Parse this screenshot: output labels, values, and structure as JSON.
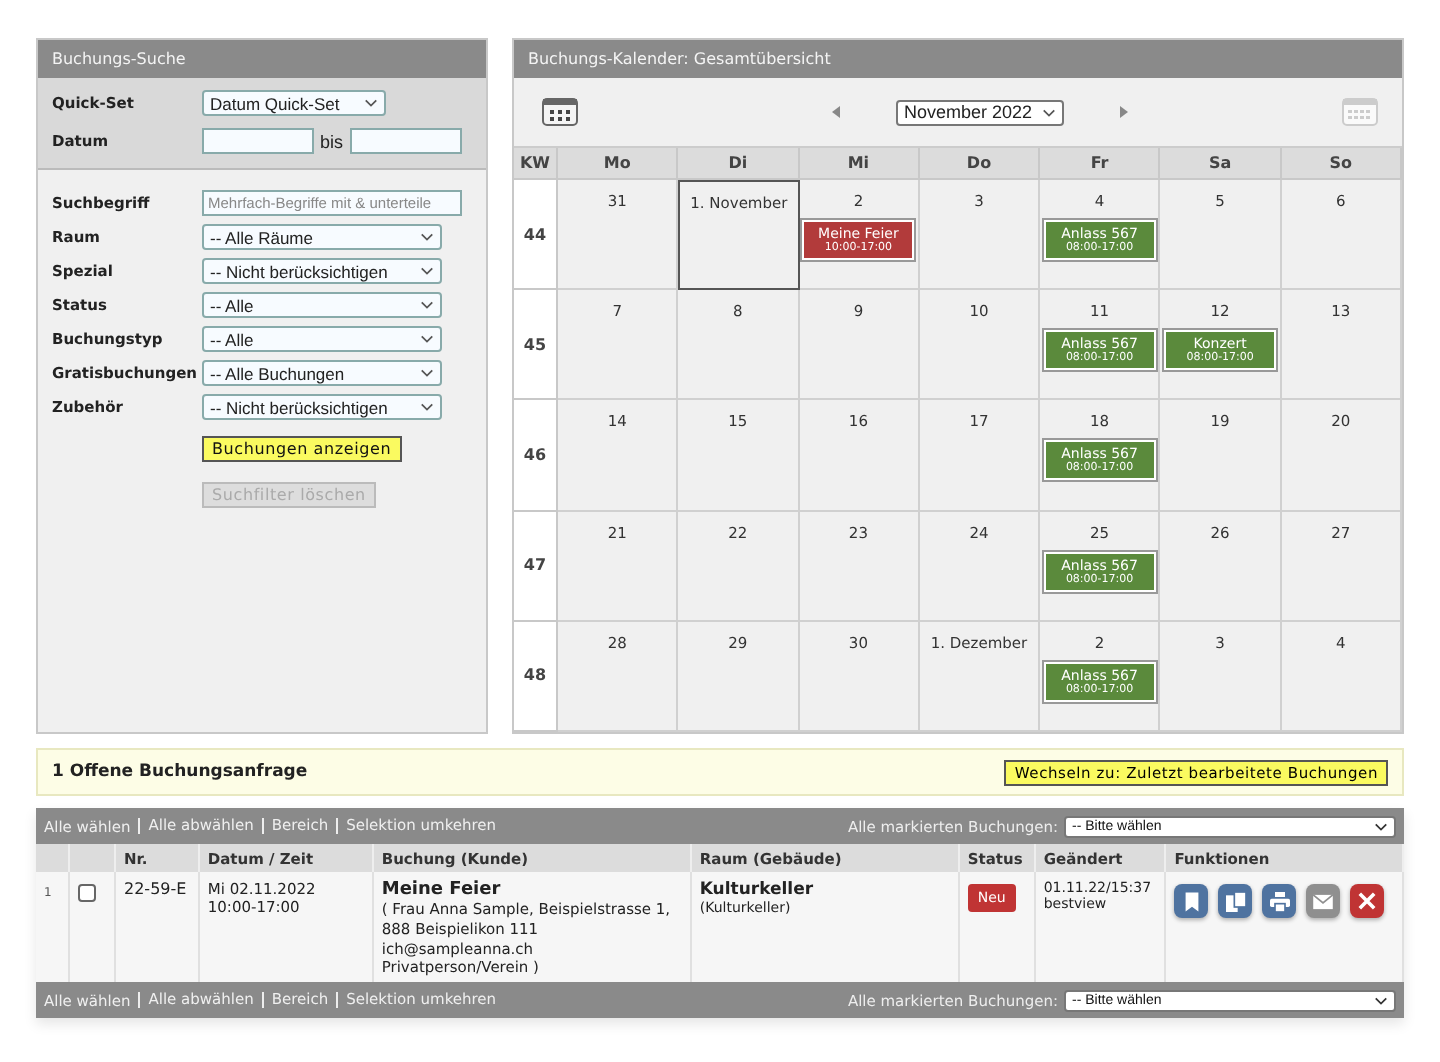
{
  "search": {
    "title": "Buchungs-Suche",
    "top_fields": [
      {
        "kind": "select",
        "label": "Quick-Set",
        "value": "Datum Quick-Set"
      },
      {
        "kind": "daterange",
        "label": "Datum",
        "separator": "bis"
      }
    ],
    "fields": [
      {
        "kind": "text",
        "label": "Suchbegriff",
        "placeholder": "Mehrfach-Begriffe mit & unterteile"
      },
      {
        "kind": "select",
        "label": "Raum",
        "value": "-- Alle Räume"
      },
      {
        "kind": "select",
        "label": "Spezial",
        "value": "-- Nicht berücksichtigen"
      },
      {
        "kind": "select",
        "label": "Status",
        "value": "-- Alle"
      },
      {
        "kind": "select",
        "label": "Buchungstyp",
        "value": "-- Alle"
      },
      {
        "kind": "select",
        "label": "Gratisbuchungen",
        "value": "-- Alle Buchungen"
      },
      {
        "kind": "select",
        "label": "Zubehör",
        "value": "-- Nicht berücksichtigen"
      }
    ],
    "buttons": [
      {
        "label": "Buchungen anzeigen",
        "disabled": false
      },
      {
        "label": "Suchfilter löschen",
        "disabled": true
      }
    ]
  },
  "calendar": {
    "title": "Buchungs-Kalender: Gesamtübersicht",
    "month": "November 2022",
    "kw_label": "KW",
    "weekdays": [
      "Mo",
      "Di",
      "Mi",
      "Do",
      "Fr",
      "Sa",
      "So"
    ],
    "weeks": [
      {
        "kw": "44",
        "days": [
          {
            "label": "31",
            "selected": false
          },
          {
            "label": "1. November",
            "selected": true
          },
          {
            "label": "2",
            "selected": false,
            "events": [
              {
                "title": "Meine Feier",
                "time": "10:00-17:00",
                "color": "#b23b3b"
              }
            ]
          },
          {
            "label": "3",
            "selected": false
          },
          {
            "label": "4",
            "selected": false,
            "events": [
              {
                "title": "Anlass 567",
                "time": "08:00-17:00",
                "color": "#5b8a3c"
              }
            ]
          },
          {
            "label": "5",
            "selected": false
          },
          {
            "label": "6",
            "selected": false
          }
        ]
      },
      {
        "kw": "45",
        "days": [
          {
            "label": "7",
            "selected": false
          },
          {
            "label": "8",
            "selected": false
          },
          {
            "label": "9",
            "selected": false
          },
          {
            "label": "10",
            "selected": false
          },
          {
            "label": "11",
            "selected": false,
            "events": [
              {
                "title": "Anlass 567",
                "time": "08:00-17:00",
                "color": "#5b8a3c"
              }
            ]
          },
          {
            "label": "12",
            "selected": false,
            "events": [
              {
                "title": "Konzert",
                "time": "08:00-17:00",
                "color": "#5b8a3c"
              }
            ]
          },
          {
            "label": "13",
            "selected": false
          }
        ]
      },
      {
        "kw": "46",
        "days": [
          {
            "label": "14",
            "selected": false
          },
          {
            "label": "15",
            "selected": false
          },
          {
            "label": "16",
            "selected": false
          },
          {
            "label": "17",
            "selected": false
          },
          {
            "label": "18",
            "selected": false,
            "events": [
              {
                "title": "Anlass 567",
                "time": "08:00-17:00",
                "color": "#5b8a3c"
              }
            ]
          },
          {
            "label": "19",
            "selected": false
          },
          {
            "label": "20",
            "selected": false
          }
        ]
      },
      {
        "kw": "47",
        "days": [
          {
            "label": "21",
            "selected": false
          },
          {
            "label": "22",
            "selected": false
          },
          {
            "label": "23",
            "selected": false
          },
          {
            "label": "24",
            "selected": false
          },
          {
            "label": "25",
            "selected": false,
            "events": [
              {
                "title": "Anlass 567",
                "time": "08:00-17:00",
                "color": "#5b8a3c"
              }
            ]
          },
          {
            "label": "26",
            "selected": false
          },
          {
            "label": "27",
            "selected": false
          }
        ]
      },
      {
        "kw": "48",
        "days": [
          {
            "label": "28",
            "selected": false
          },
          {
            "label": "29",
            "selected": false
          },
          {
            "label": "30",
            "selected": false
          },
          {
            "label": "1. Dezember",
            "selected": false
          },
          {
            "label": "2",
            "selected": false,
            "events": [
              {
                "title": "Anlass 567",
                "time": "08:00-17:00",
                "color": "#5b8a3c"
              }
            ]
          },
          {
            "label": "3",
            "selected": false
          },
          {
            "label": "4",
            "selected": false
          }
        ]
      }
    ]
  },
  "requests": {
    "heading": "1 Offene Buchungsanfrage",
    "switch_button": "Wechseln zu: Zuletzt bearbeitete Buchungen"
  },
  "table": {
    "toolbar": {
      "links": [
        "Alle wählen",
        "Alle abwählen",
        "Bereich",
        "Selektion umkehren"
      ],
      "bulk_label": "Alle markierten Buchungen:",
      "bulk_value": "-- Bitte wählen"
    },
    "columns": [
      "Nr.",
      "Datum / Zeit",
      "Buchung (Kunde)",
      "Raum (Gebäude)",
      "Status",
      "Geändert",
      "Funktionen"
    ],
    "rows": [
      {
        "index": "1",
        "checked": false,
        "nr": "22-59-E",
        "date": "Mi 02.11.2022",
        "time": "10:00-17:00",
        "booking": "Meine Feier",
        "customer": "( Frau Anna Sample, Beispielstrasse 1, 888 Beispielikon 111 ich@sampleanna.ch Privatperson/Verein )",
        "room": "Kulturkeller",
        "building": "(Kulturkeller)",
        "status": "Neu",
        "changed": "01.11.22/15:37",
        "changed_by": "bestview",
        "actions": [
          {
            "kind": "bookmark"
          },
          {
            "kind": "copy"
          },
          {
            "kind": "print"
          },
          {
            "kind": "mail"
          },
          {
            "kind": "delete"
          }
        ]
      }
    ],
    "footer": {
      "links": [
        "Alle wählen",
        "Alle abwählen",
        "Bereich",
        "Selektion umkehren"
      ],
      "bulk_label": "Alle markierten Buchungen:",
      "bulk_value": "-- Bitte wählen"
    }
  }
}
